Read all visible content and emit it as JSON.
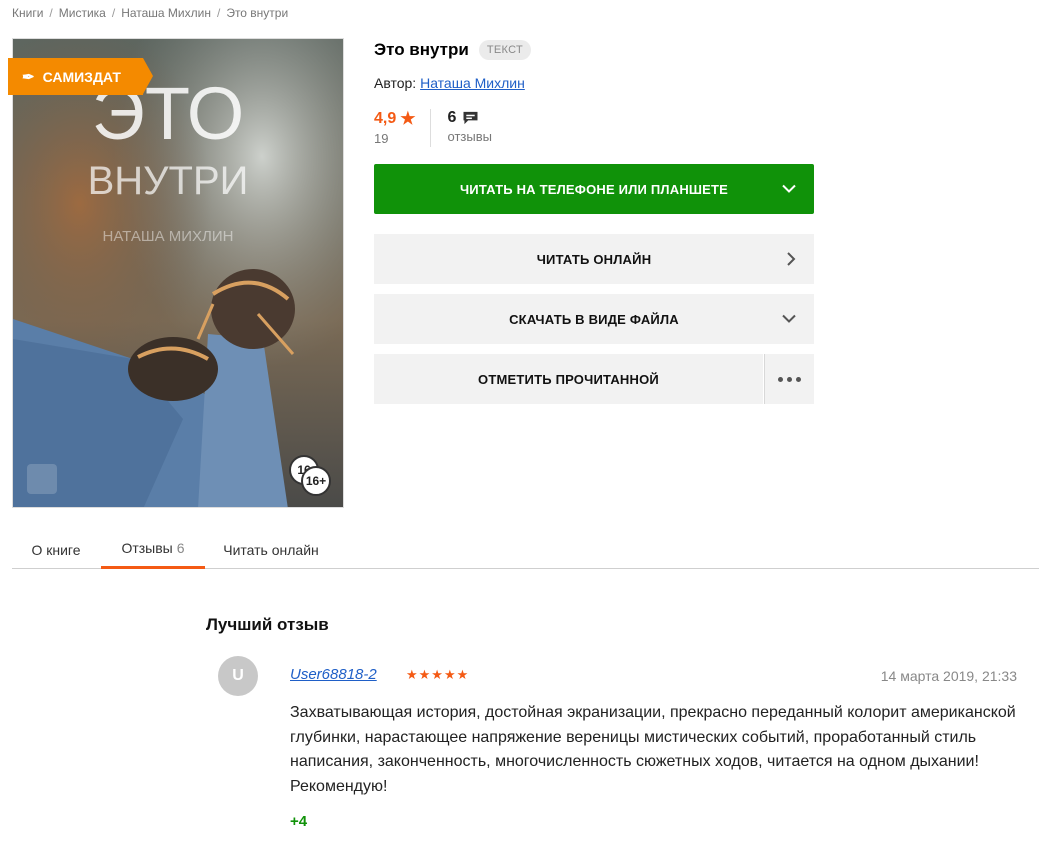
{
  "breadcrumbs": [
    "Книги",
    "Мистика",
    "Наташа Михлин",
    "Это внутри"
  ],
  "cover": {
    "badge_label": "САМИЗДАТ",
    "badge_icon": "feather-icon",
    "cover_title_line1": "ЭТО",
    "cover_title_line2": "ВНУТРИ",
    "cover_author": "НАТАША МИХЛИН",
    "age_back": "16",
    "age_front": "16+"
  },
  "book": {
    "title": "Это внутри",
    "type_tag": "ТЕКСТ",
    "author_label": "Автор:",
    "author_name": "Наташа Михлин",
    "rating": "4,9",
    "rating_count": "19",
    "reviews_count": "6",
    "reviews_label": "отзывы"
  },
  "actions": {
    "read_phone": "ЧИТАТЬ НА ТЕЛЕФОНЕ ИЛИ ПЛАНШЕТЕ",
    "read_online": "ЧИТАТЬ ОНЛАЙН",
    "download": "СКАЧАТЬ В ВИДЕ ФАЙЛА",
    "mark_read": "ОТМЕТИТЬ ПРОЧИТАННОЙ"
  },
  "tabs": {
    "about": "О книге",
    "reviews": "Отзывы",
    "reviews_count": "6",
    "read_online": "Читать онлайн"
  },
  "review": {
    "heading": "Лучший отзыв",
    "avatar_letter": "U",
    "user": "User68818-2",
    "stars": "★★★★★",
    "date": "14 марта 2019, 21:33",
    "text": "Захватывающая история, достойная экранизации, прекрасно переданный колорит американской глубинки, нарастающее напряжение вереницы мистических событий, проработанный стиль написания, законченность, многочисленность сюжетных ходов, читается на одном дыхании! Рекомендую!",
    "votes": "+4"
  },
  "colors": {
    "accent_orange": "#f45a14",
    "badge_orange": "#f48a00",
    "green": "#109209",
    "link_blue": "#1f5fc7"
  }
}
